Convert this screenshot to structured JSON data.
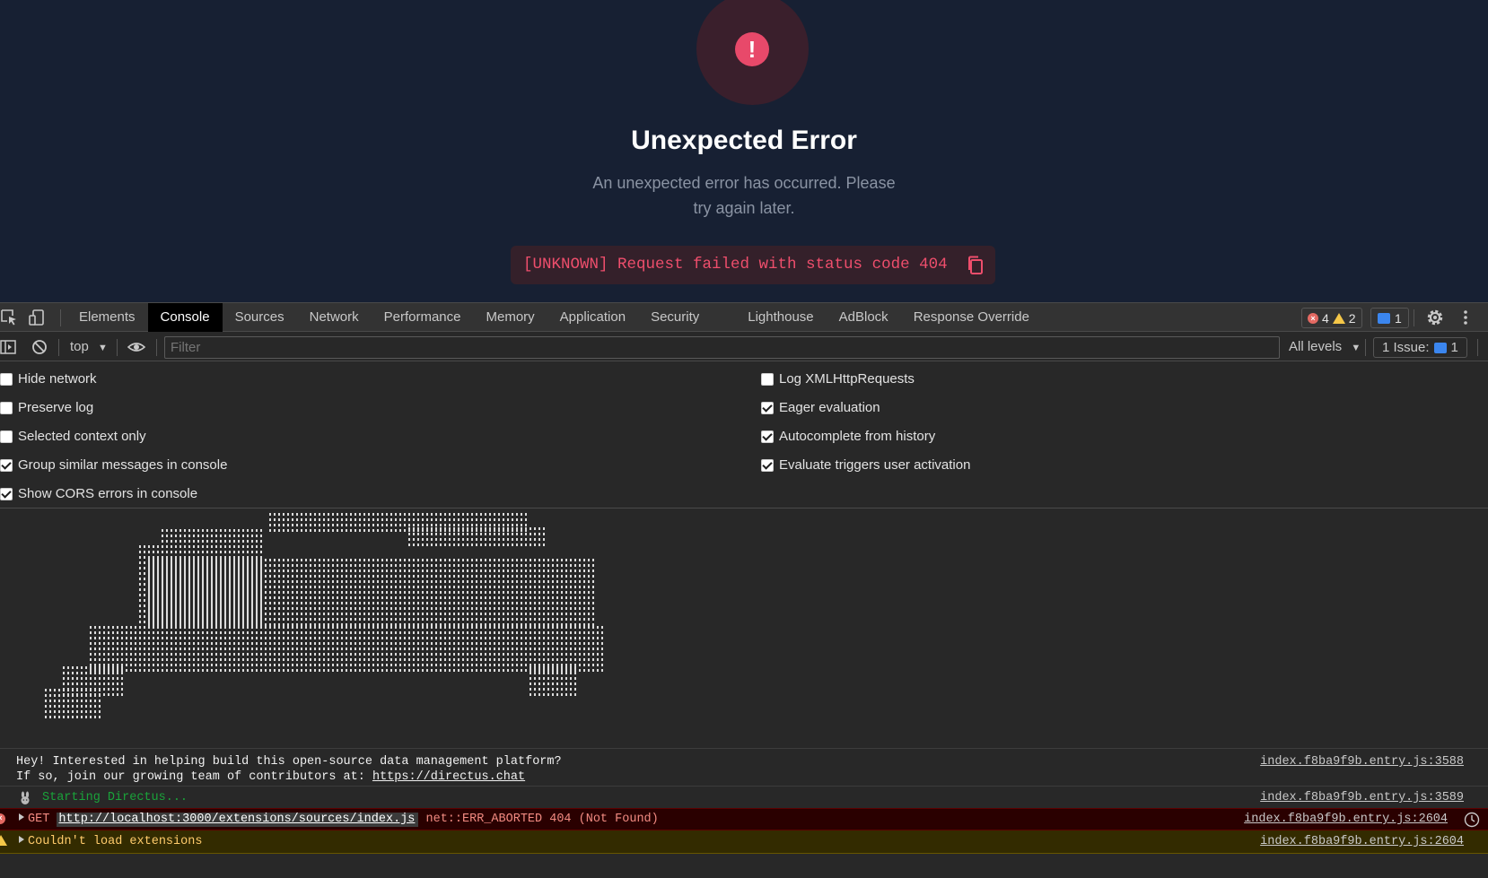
{
  "app": {
    "error_symbol": "!",
    "title": "Unexpected Error",
    "description": "An unexpected error has occurred. Please try again later.",
    "error_code": "[UNKNOWN] Request failed with status code 404"
  },
  "devtools": {
    "tabs": [
      {
        "label": "Elements"
      },
      {
        "label": "Console"
      },
      {
        "label": "Sources"
      },
      {
        "label": "Network"
      },
      {
        "label": "Performance"
      },
      {
        "label": "Memory"
      },
      {
        "label": "Application"
      },
      {
        "label": "Security"
      },
      {
        "label": "Lighthouse"
      },
      {
        "label": "AdBlock"
      },
      {
        "label": "Response Override"
      }
    ],
    "counts": {
      "errors": "4",
      "warnings": "2",
      "messages": "1"
    },
    "toolbar": {
      "context": "top",
      "filter_placeholder": "Filter",
      "levels": "All levels",
      "issues_label": "1 Issue:",
      "issues_count": "1"
    },
    "settings_left": [
      {
        "label": "Hide network"
      },
      {
        "label": "Preserve log"
      },
      {
        "label": "Selected context only"
      },
      {
        "label": "Group similar messages in console"
      },
      {
        "label": "Show CORS errors in console"
      }
    ],
    "settings_right": [
      {
        "label": "Log XMLHttpRequests"
      },
      {
        "label": "Eager evaluation"
      },
      {
        "label": "Autocomplete from history"
      },
      {
        "label": "Evaluate triggers user activation"
      }
    ],
    "messages": {
      "info_line1": "Hey! Interested in helping build this open-source data management platform?",
      "info_line2_prefix": "If so, join our growing team of contributors at: ",
      "info_link": "https://directus.chat",
      "info_source": "index.f8ba9f9b.entry.js:3588",
      "start_text": "Starting Directus...",
      "start_source": "index.f8ba9f9b.entry.js:3589",
      "error_method": "GET",
      "error_url": "http://localhost:3000/extensions/sources/index.js",
      "error_text": "net::ERR_ABORTED 404 (Not Found)",
      "error_source": "index.f8ba9f9b.entry.js:2604",
      "warn_text": "Couldn't load extensions",
      "warn_source": "index.f8ba9f9b.entry.js:2604"
    }
  },
  "colors": {
    "app_background": "#172033",
    "error_accent": "#e8496a",
    "devtools_background": "#282828",
    "console_error_text": "#f28b82",
    "console_warning_text": "#ffcb6b",
    "console_start_text": "#1aa33a"
  }
}
